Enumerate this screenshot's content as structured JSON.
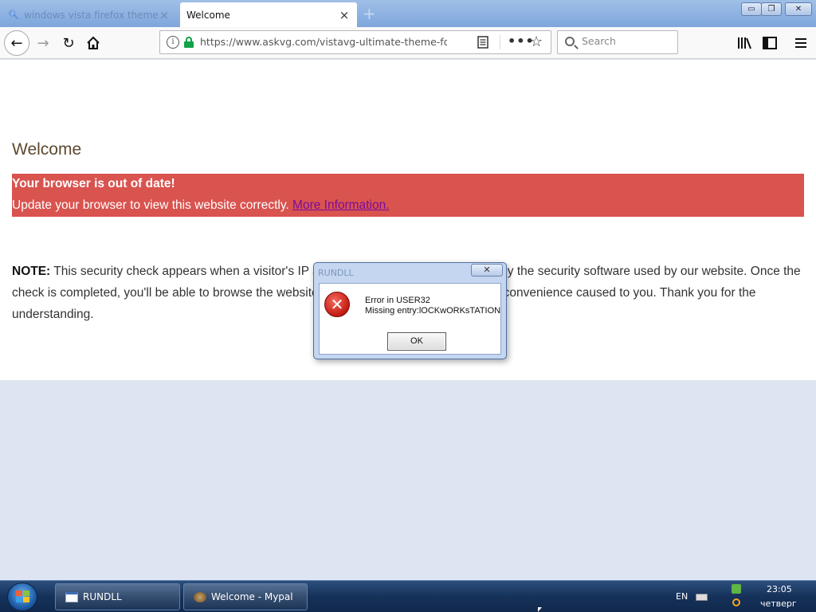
{
  "browser": {
    "tabs": [
      {
        "title": "windows vista firefox theme",
        "active": false
      },
      {
        "title": "Welcome",
        "active": true
      }
    ],
    "new_tab_label": "+",
    "url": "https://www.askvg.com/vistavg-ultimate-theme-for-w",
    "search_placeholder": "Search",
    "window_controls": {
      "minimize": "▭",
      "restore": "❐",
      "close": "✕"
    }
  },
  "page": {
    "heading": "Welcome",
    "alert": {
      "title": "Your browser is out of date!",
      "text": "Update your browser to view this website correctly. ",
      "link": "More Information."
    },
    "note": {
      "label": "NOTE:",
      "text": " This security check appears when a visitor's IP address is detected as suspicious by the security software used by our website. Once the check is completed, you'll be able to browse the website normally. We apologize for any inconvenience caused to you. Thank you for the understanding."
    }
  },
  "dialog": {
    "title": "RUNDLL",
    "close_label": "✕",
    "line1": "Error in USER32",
    "line2": "Missing entry:lOCKwORKsTATION",
    "ok_label": "OK"
  },
  "taskbar": {
    "buttons": [
      {
        "label": "RUNDLL"
      },
      {
        "label": "Welcome - Mypal"
      }
    ],
    "language": "EN",
    "clock_time": "23:05",
    "clock_day": "четверг"
  },
  "colors": {
    "alert_bg": "#d9534f",
    "link": "#7a0c9e",
    "heading": "#5c4a2e",
    "desktop_bg": "#dde5f3"
  }
}
